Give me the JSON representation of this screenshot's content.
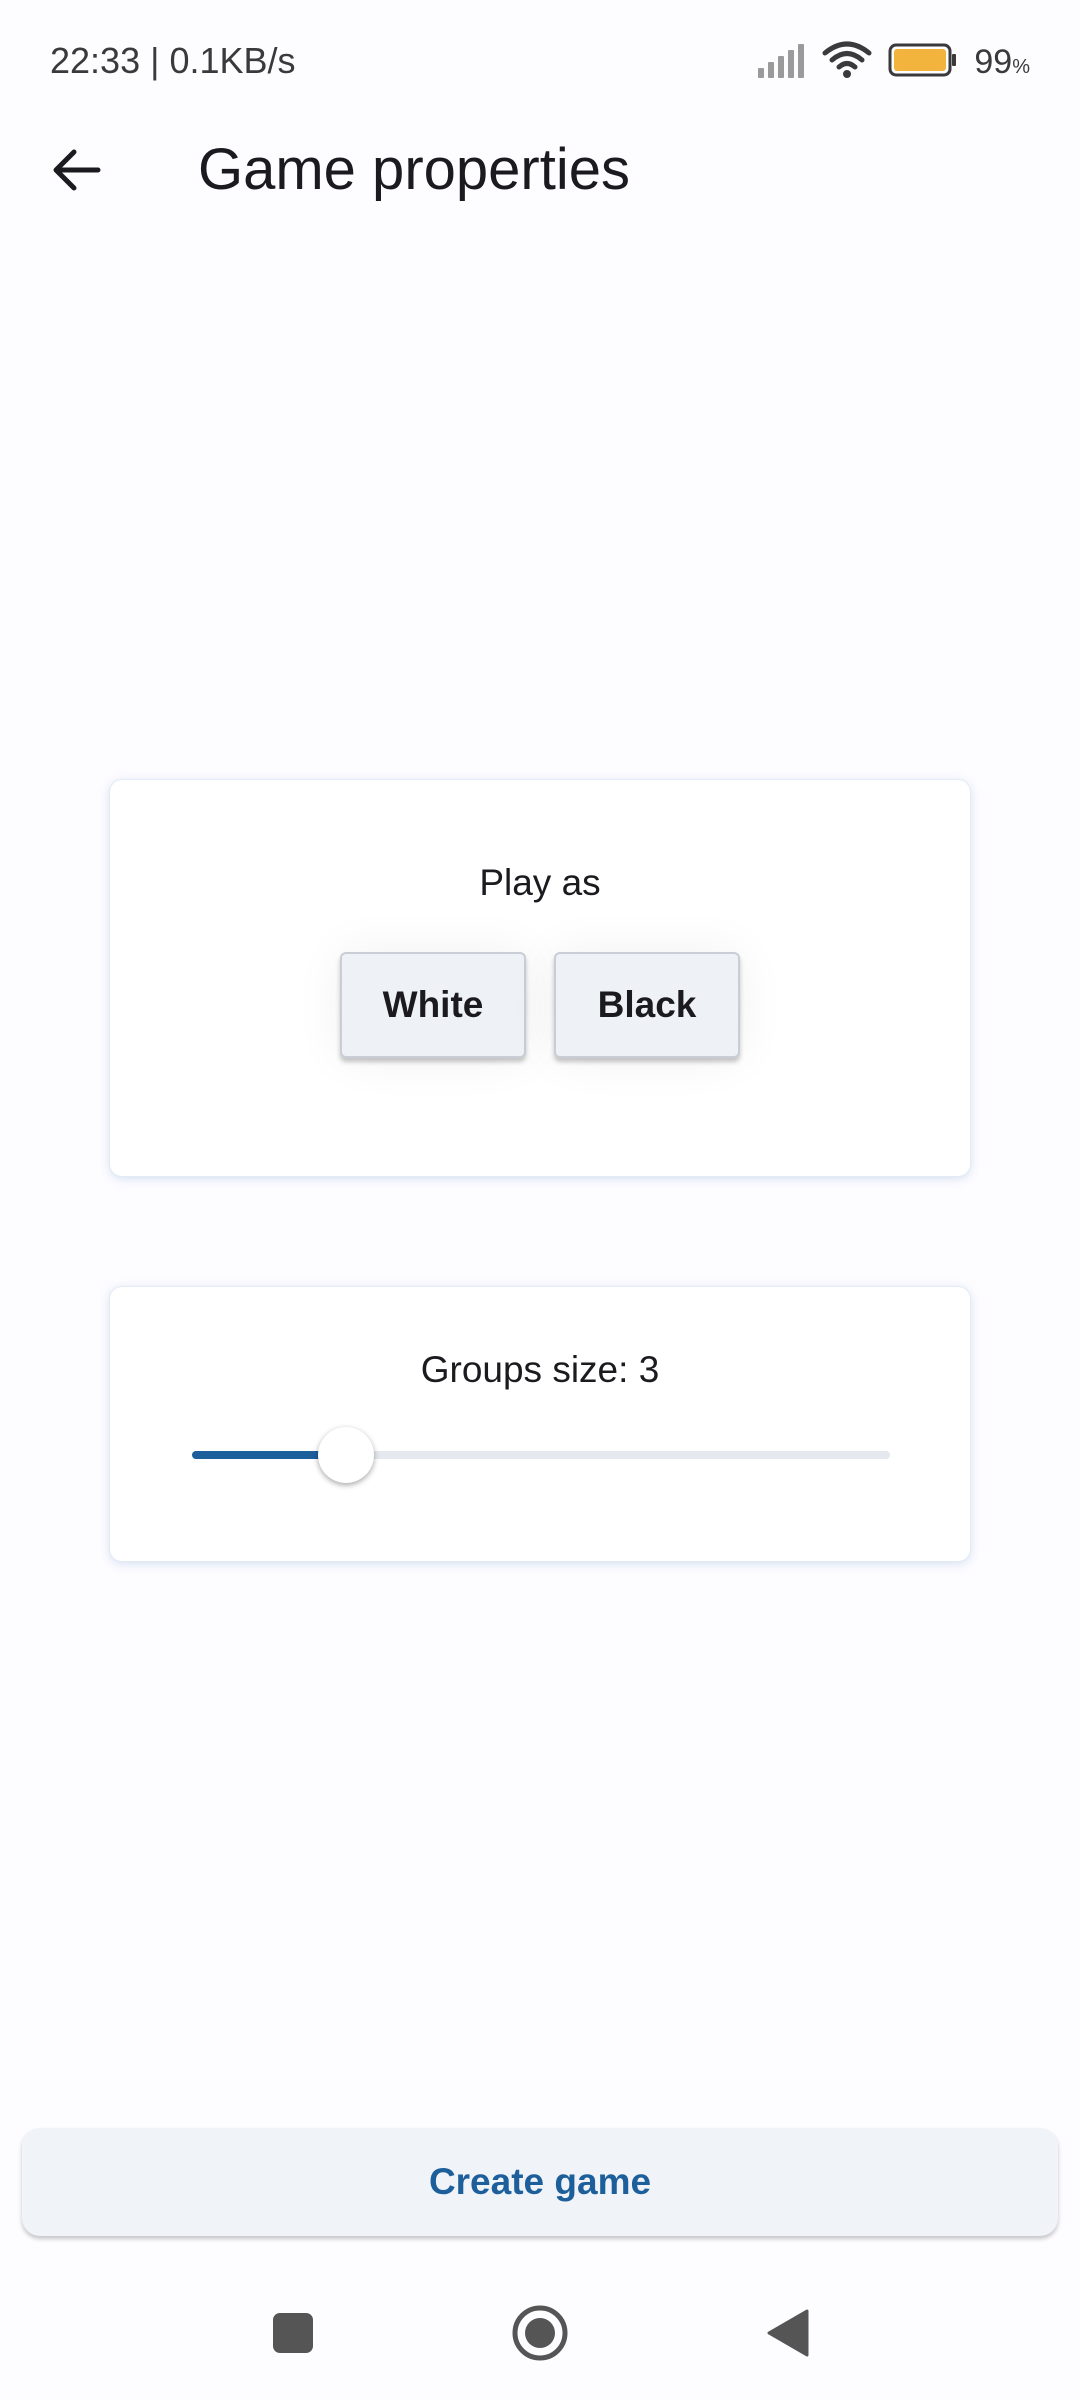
{
  "status_bar": {
    "time_speed": "22:33 | 0.1KB/s",
    "battery_percent": "99",
    "battery_unit": "%",
    "icons": [
      "signal-icon",
      "wifi-icon",
      "battery-icon"
    ]
  },
  "app_bar": {
    "title": "Game properties",
    "back_icon": "arrow-back-icon"
  },
  "play_as": {
    "heading": "Play as",
    "options": [
      "White",
      "Black"
    ]
  },
  "groups": {
    "heading": "Groups size: 3",
    "slider_value": 3,
    "slider_fraction": 0.22
  },
  "create_button": {
    "label": "Create game"
  },
  "nav_bar": {
    "icons": [
      "recents-square-icon",
      "home-circle-icon",
      "back-triangle-icon"
    ]
  },
  "colors": {
    "accent": "#1d5f9b",
    "background": "#fdfcff",
    "button_surface": "#eef2f7",
    "battery": "#f2b43c"
  }
}
